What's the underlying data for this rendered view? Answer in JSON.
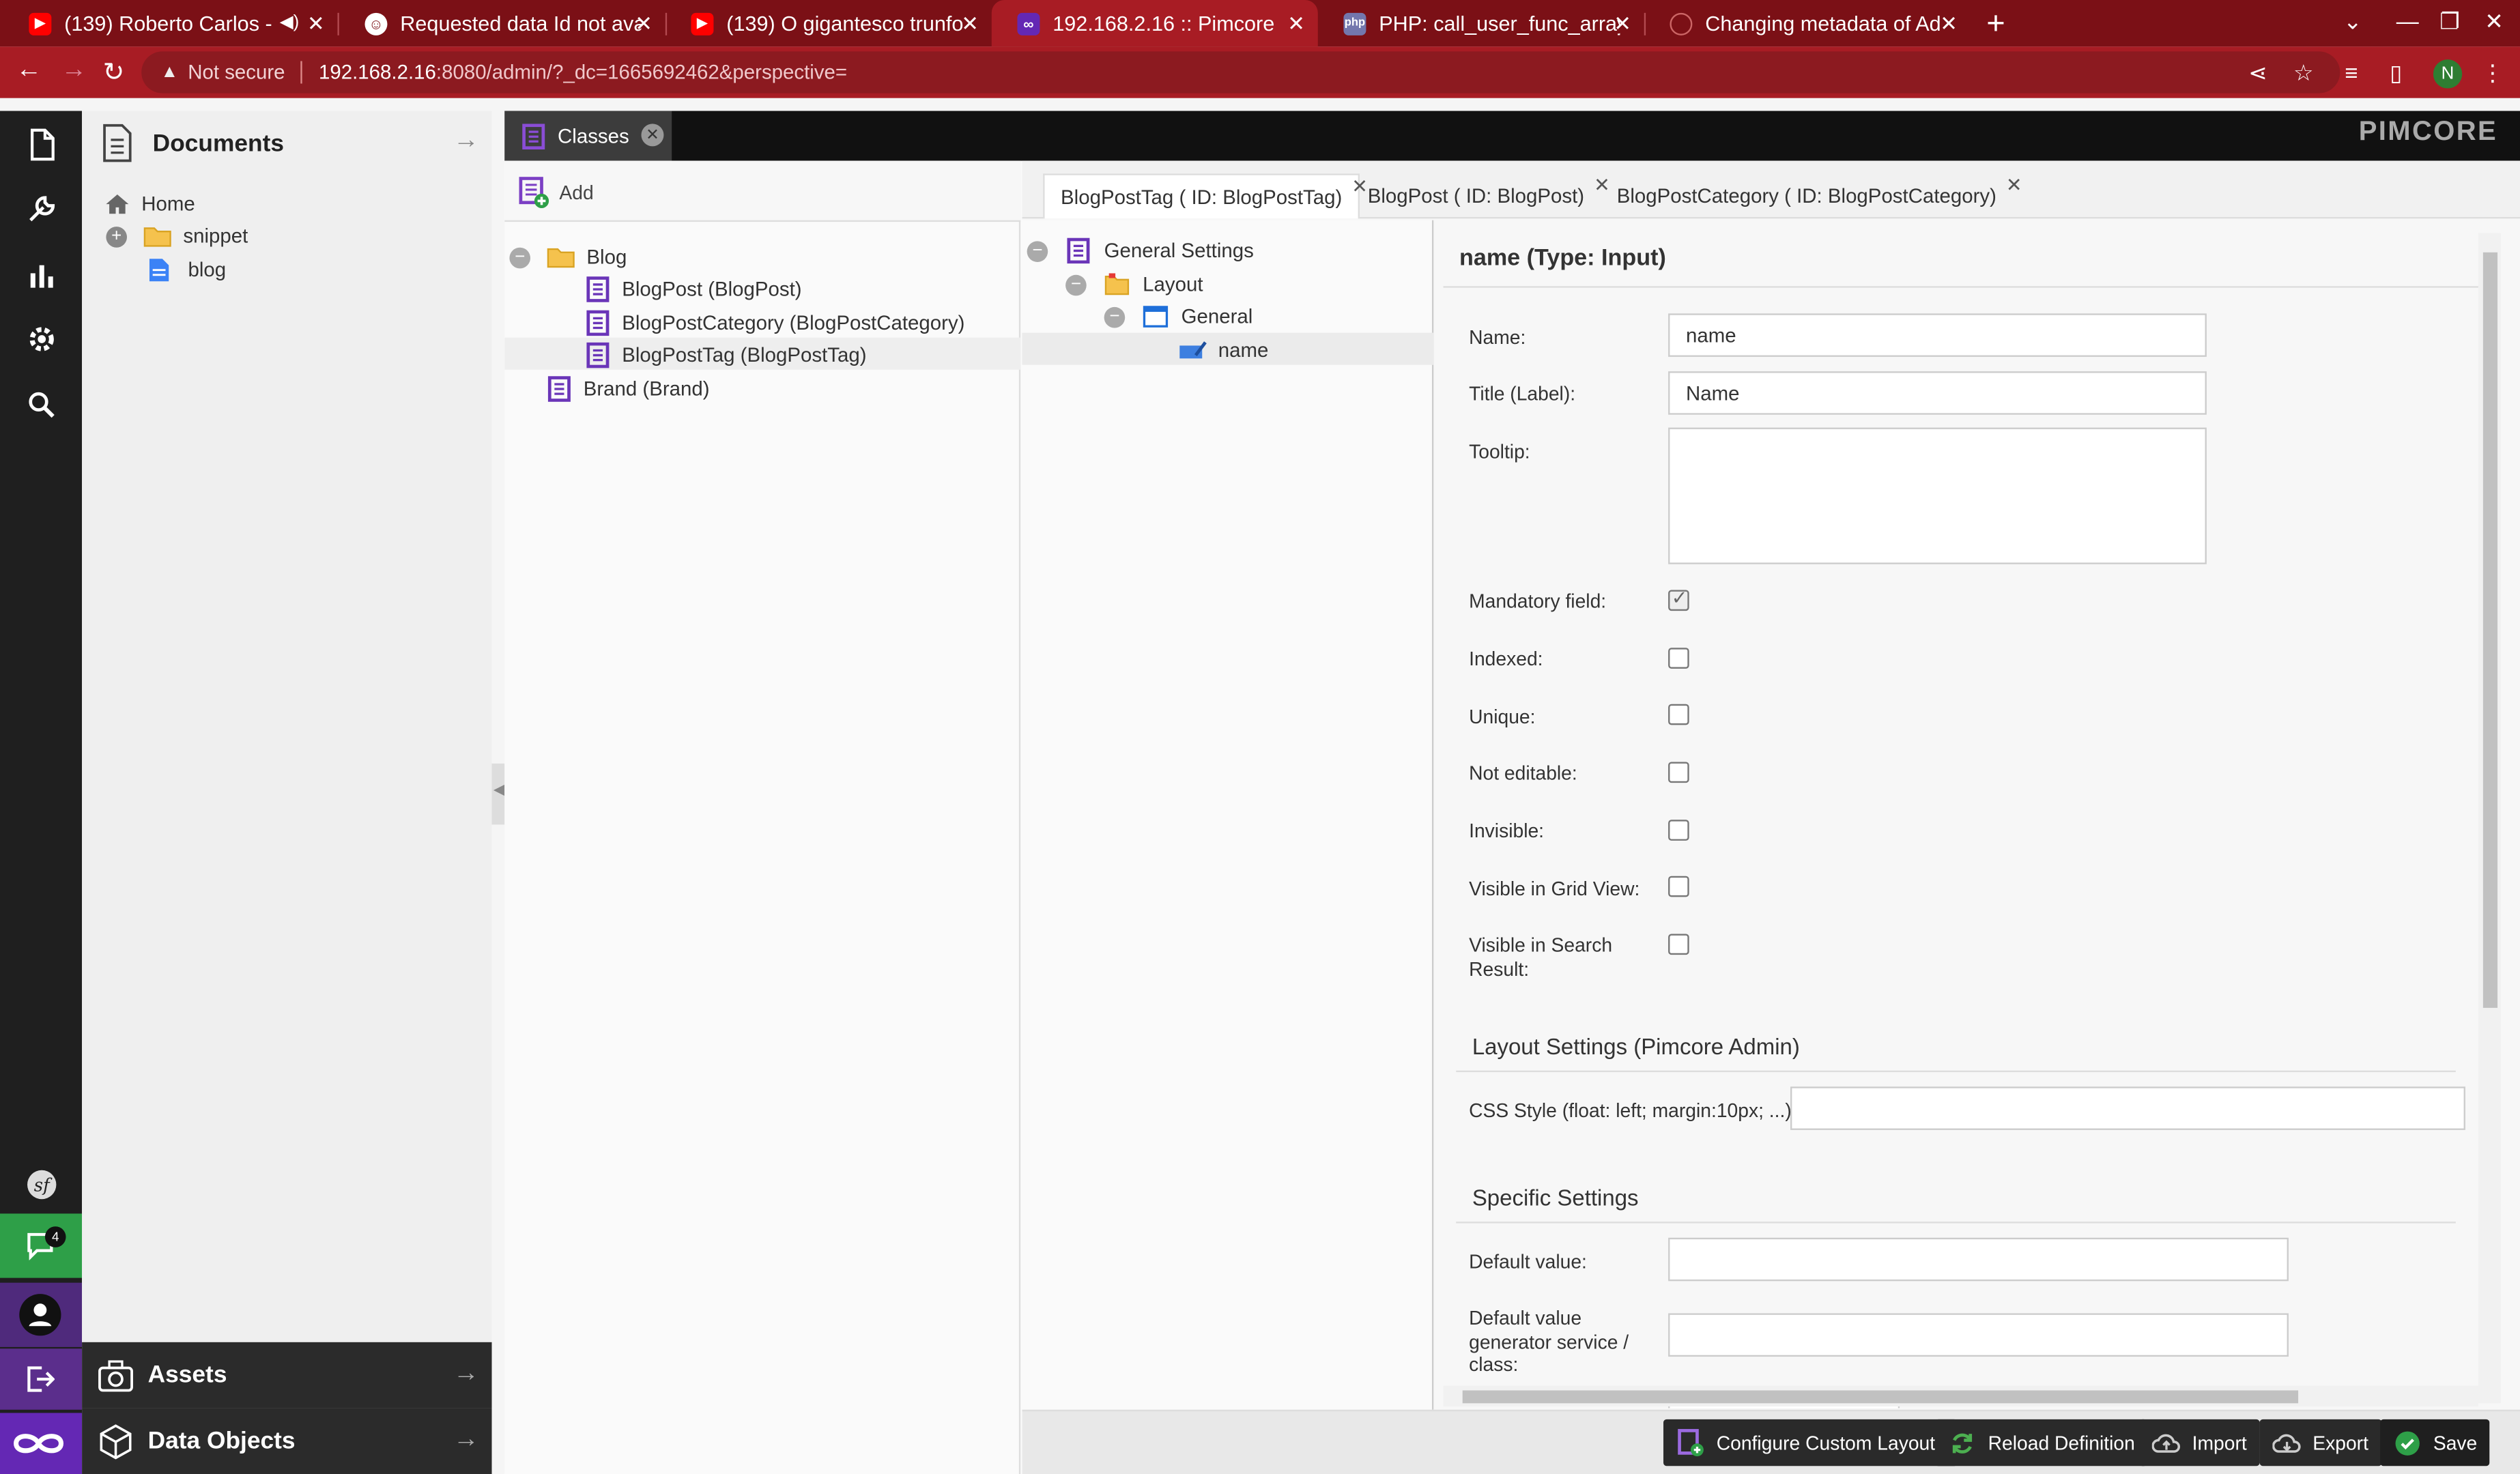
{
  "browser": {
    "tabs": [
      {
        "title": "(139) Roberto Carlos -",
        "icon": "youtube-icon",
        "audio": true
      },
      {
        "title": "Requested data Id not ava",
        "icon": "github-octocat-icon"
      },
      {
        "title": "(139) O gigantesco trunfo",
        "icon": "youtube-icon"
      },
      {
        "title": "192.168.2.16 :: Pimcore",
        "icon": "pimcore-icon",
        "active": true
      },
      {
        "title": "PHP: call_user_func_array",
        "icon": "php-icon"
      },
      {
        "title": "Changing metadata of Ad",
        "icon": "github-icon"
      }
    ],
    "address": {
      "warning": "Not secure",
      "host": "192.168.2.16",
      "path": ":8080/admin/?_dc=1665692462&perspective="
    },
    "profile_initial": "N"
  },
  "sidebar": {
    "notifications_count": "4"
  },
  "documents": {
    "title": "Documents",
    "tree": [
      {
        "label": "Home",
        "icon": "home-icon"
      },
      {
        "label": "snippet",
        "icon": "folder-icon"
      },
      {
        "label": "blog",
        "icon": "document-icon"
      }
    ]
  },
  "bottom_panels": {
    "assets": "Assets",
    "data_objects": "Data Objects"
  },
  "main": {
    "classes_tab": "Classes",
    "add_label": "Add",
    "class_tree": {
      "folder": "Blog",
      "items": [
        "BlogPost (BlogPost)",
        "BlogPostCategory (BlogPostCategory)",
        "BlogPostTag (BlogPostTag)"
      ],
      "root_items": [
        "Brand (Brand)"
      ]
    },
    "editor_tabs": [
      {
        "label": "BlogPostTag ( ID: BlogPostTag)",
        "active": true
      },
      {
        "label": "BlogPost ( ID: BlogPost)"
      },
      {
        "label": "BlogPostCategory ( ID: BlogPostCategory)"
      }
    ],
    "layout_tree": {
      "root": "General Settings",
      "layout": "Layout",
      "panel": "General",
      "field": "name"
    }
  },
  "form": {
    "title": "name (Type: Input)",
    "name_label": "Name:",
    "name_value": "name",
    "title_label": "Title (Label):",
    "title_value": "Name",
    "tooltip_label": "Tooltip:",
    "mandatory_label": "Mandatory field:",
    "indexed_label": "Indexed:",
    "unique_label": "Unique:",
    "not_editable_label": "Not editable:",
    "invisible_label": "Invisible:",
    "visible_grid_label": "Visible in Grid View:",
    "visible_search_label_1": "Visible in Search",
    "visible_search_label_2": "Result:",
    "layout_section": "Layout Settings (Pimcore Admin)",
    "css_label": "CSS Style (float: left; margin:10px; ...):",
    "specific_section": "Specific Settings",
    "default_value_label": "Default value:",
    "default_gen_label_1": "Default value",
    "default_gen_label_2": "generator service /",
    "default_gen_label_3": "class:"
  },
  "buttons": {
    "configure": "Configure Custom Layouts",
    "reload": "Reload Definition",
    "import": "Import",
    "export": "Export",
    "save": "Save"
  },
  "brand_logo": "PIMCORE",
  "colors": {
    "browser_frame": "#a81c24",
    "pimcore_purple": "#6428b4",
    "chat_green": "#2e9f48"
  }
}
